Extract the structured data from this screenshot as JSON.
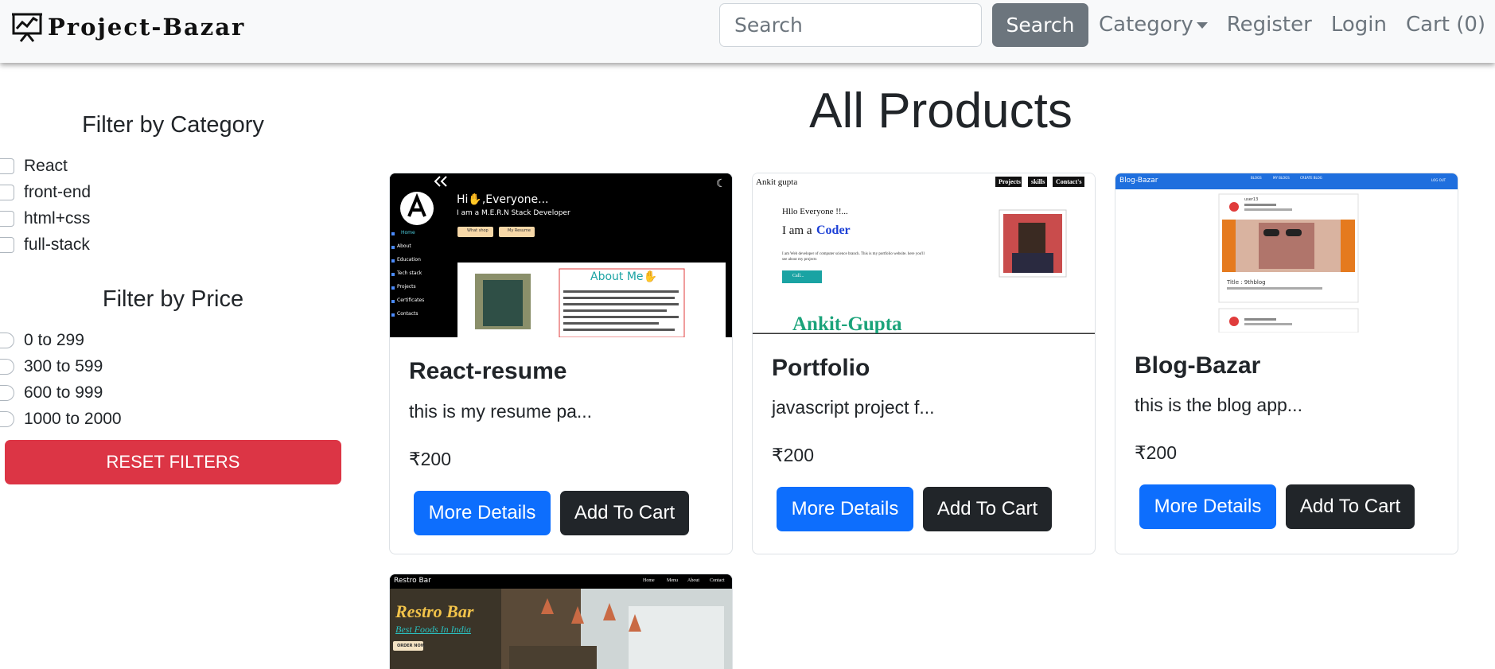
{
  "navbar": {
    "brand": "Project-Bazar",
    "search_placeholder": "Search",
    "search_button": "Search",
    "links": {
      "category": "Category",
      "register": "Register",
      "login": "Login",
      "cart": "Cart (0)"
    }
  },
  "sidebar": {
    "category_title": "Filter by Category",
    "categories": [
      "React",
      "front-end",
      "html+css",
      "full-stack"
    ],
    "price_title": "Filter by Price",
    "prices": [
      "0 to 299",
      "300 to 599",
      "600 to 999",
      "1000 to 2000"
    ],
    "reset_button": "RESET FILTERS"
  },
  "main": {
    "title": "All Products",
    "products": [
      {
        "name": "React-resume",
        "description": "this is my resume pa...",
        "price": "₹200",
        "details_button": "More Details",
        "cart_button": "Add To Cart",
        "thumb": {
          "greeting": "Hi✋,Everyone...",
          "subtitle": "I am a M.E.R.N Stack Developer",
          "btn1": "What shop",
          "btn2": "My Resume",
          "menu": [
            "Home",
            "About",
            "Education",
            "Tech stack",
            "Projects",
            "Certificates",
            "Contacts"
          ],
          "about_title": "About Me✋"
        }
      },
      {
        "name": "Portfolio",
        "description": "javascript project f...",
        "price": "₹200",
        "details_button": "More Details",
        "cart_button": "Add To Cart",
        "thumb": {
          "logo": "Ankit gupta",
          "nav": [
            "Projects",
            "skills",
            "Contact's"
          ],
          "hello": "Hllo Everyone !!...",
          "iam": "I am a",
          "coder": "Coder",
          "blurb": "I am Web developer of computer science branch. This is my portfolio website. here you'll see about my projects",
          "cta": "Call...",
          "name": "Ankit-Gupta"
        }
      },
      {
        "name": "Blog-Bazar",
        "description": "this is the blog app...",
        "price": "₹200",
        "details_button": "More Details",
        "cart_button": "Add To Cart",
        "thumb": {
          "logo": "Blog-Bazar",
          "nav": [
            "BLOGS",
            "MY BLOGS",
            "CREATE BLOG"
          ],
          "logout": "LOG OUT",
          "user": "user13",
          "blog_title": "Title : 9thblog"
        }
      },
      {
        "thumb": {
          "logo": "Restro Bar",
          "nav": [
            "Home",
            "Menu",
            "About",
            "Contact"
          ],
          "headline": "Restro Bar",
          "tagline": "Best Foods In India",
          "cta": "ORDER NOW"
        }
      }
    ]
  }
}
